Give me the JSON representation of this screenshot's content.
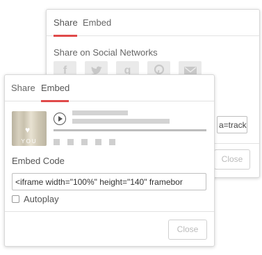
{
  "share_dialog": {
    "tabs": [
      "Share",
      "Embed"
    ],
    "active_tab": "Share",
    "section_title": "Share on Social Networks",
    "social_icons": [
      "facebook-icon",
      "twitter-icon",
      "google-plus-icon",
      "pinterest-icon",
      "email-icon"
    ],
    "link_value_fragment": "a=track",
    "close_label": "Close"
  },
  "embed_dialog": {
    "tabs": [
      "Share",
      "Embed"
    ],
    "active_tab": "Embed",
    "thumbnail_text": "YOU",
    "embed_code_label": "Embed Code",
    "embed_code_value": "<iframe width=\"100%\" height=\"140\" framebor",
    "autoplay_label": "Autoplay",
    "autoplay_checked": false,
    "close_label": "Close"
  },
  "colors": {
    "accent": "#e04a4a"
  }
}
